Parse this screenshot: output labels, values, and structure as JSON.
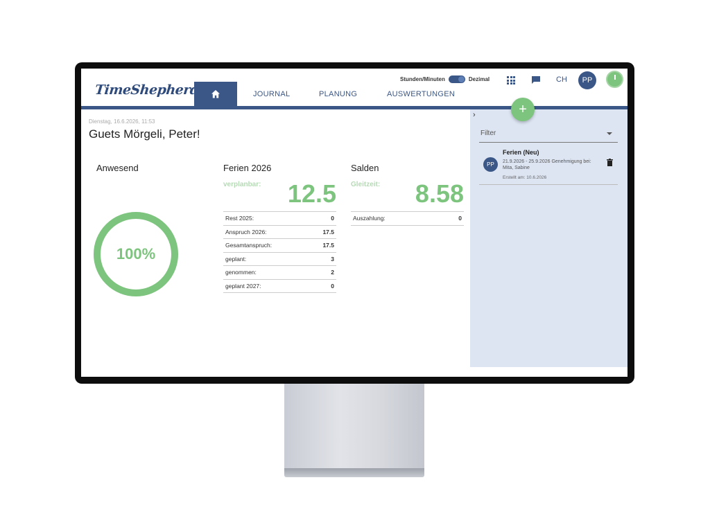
{
  "header": {
    "logo": "TimeShepherd",
    "nav": [
      "JOURNAL",
      "PLANUNG",
      "AUSWERTUNGEN"
    ],
    "toggle_left": "Stunden/Minuten",
    "toggle_right": "Dezimal",
    "lang": "CH",
    "avatar": "PP"
  },
  "dashboard": {
    "date": "Dienstag, 16.6.2026, 11:53",
    "greeting": "Guets Mörgeli, Peter!",
    "presence": {
      "title": "Anwesend",
      "percent": "100%",
      "value": 1.0
    },
    "vacation": {
      "title": "Ferien 2026",
      "big_label": "verplanbar:",
      "big_value": "12.5",
      "rows": [
        {
          "label": "Rest 2025:",
          "value": "0"
        },
        {
          "label": "Anspruch 2026:",
          "value": "17.5"
        },
        {
          "label": "Gesamtanspruch:",
          "value": "17.5"
        },
        {
          "label": "geplant:",
          "value": "3"
        },
        {
          "label": "genommen:",
          "value": "2"
        },
        {
          "label": "geplant 2027:",
          "value": "0"
        }
      ]
    },
    "balances": {
      "title": "Salden",
      "big_label": "Gleitzeit:",
      "big_value": "8.58",
      "rows": [
        {
          "label": "Auszahlung:",
          "value": "0"
        }
      ]
    }
  },
  "side_panel": {
    "filter_label": "Filter",
    "entries": [
      {
        "avatar": "PP",
        "title": "Ferien (Neu)",
        "subtitle": "21.9.2026 - 25.9.2026 Genehmigung bei: Mita, Sabine",
        "meta": "Erstellt am: 10.6.2026"
      }
    ]
  },
  "colors": {
    "brand": "#3b5787",
    "accent_green": "#7dc47e",
    "panel": "#dde5f3"
  }
}
